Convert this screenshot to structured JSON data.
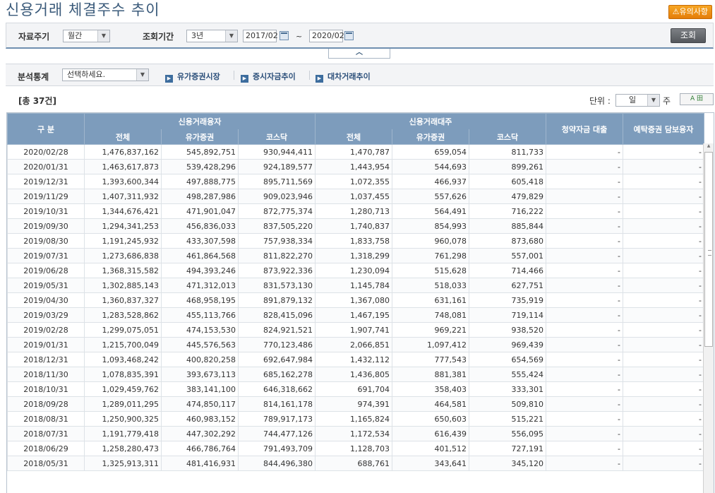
{
  "header": {
    "title": "신용거래 체결주수 추이",
    "notice_button": "⚠유의사항"
  },
  "search": {
    "period_type_label": "자료주기",
    "period_type_value": "월간",
    "range_label": "조회기간",
    "range_value": "3년",
    "start_date": "2017/02",
    "end_date": "2020/02",
    "tilde": "~",
    "query_button": "조회"
  },
  "analysis": {
    "label": "분석통계",
    "select_value": "선택하세요.",
    "links": [
      "유가증권시장",
      "증시자금추이",
      "대차거래추이"
    ]
  },
  "summary": {
    "total": "[총 37건]",
    "unit_label": "단위 :",
    "unit_value": "일",
    "unit_suffix": "주",
    "excel_label": "A 田"
  },
  "table": {
    "headers": {
      "date": "구 분",
      "group_loan": "신용거래융자",
      "group_lend": "신용거래대주",
      "subscription": "청약자금 대출",
      "deposit": "예탁증권 담보융자",
      "total": "전체",
      "kospi": "유가증권",
      "kosdaq": "코스닥"
    },
    "rows": [
      [
        "2020/02/28",
        "1,476,837,162",
        "545,892,751",
        "930,944,411",
        "1,470,787",
        "659,054",
        "811,733",
        "-",
        "-"
      ],
      [
        "2020/01/31",
        "1,463,617,873",
        "539,428,296",
        "924,189,577",
        "1,443,954",
        "544,693",
        "899,261",
        "-",
        "-"
      ],
      [
        "2019/12/31",
        "1,393,600,344",
        "497,888,775",
        "895,711,569",
        "1,072,355",
        "466,937",
        "605,418",
        "-",
        "-"
      ],
      [
        "2019/11/29",
        "1,407,311,932",
        "498,287,986",
        "909,023,946",
        "1,037,455",
        "557,626",
        "479,829",
        "-",
        "-"
      ],
      [
        "2019/10/31",
        "1,344,676,421",
        "471,901,047",
        "872,775,374",
        "1,280,713",
        "564,491",
        "716,222",
        "-",
        "-"
      ],
      [
        "2019/09/30",
        "1,294,341,253",
        "456,836,033",
        "837,505,220",
        "1,740,837",
        "854,993",
        "885,844",
        "-",
        "-"
      ],
      [
        "2019/08/30",
        "1,191,245,932",
        "433,307,598",
        "757,938,334",
        "1,833,758",
        "960,078",
        "873,680",
        "-",
        "-"
      ],
      [
        "2019/07/31",
        "1,273,686,838",
        "461,864,568",
        "811,822,270",
        "1,318,299",
        "761,298",
        "557,001",
        "-",
        "-"
      ],
      [
        "2019/06/28",
        "1,368,315,582",
        "494,393,246",
        "873,922,336",
        "1,230,094",
        "515,628",
        "714,466",
        "-",
        "-"
      ],
      [
        "2019/05/31",
        "1,302,885,143",
        "471,312,013",
        "831,573,130",
        "1,145,784",
        "518,033",
        "627,751",
        "-",
        "-"
      ],
      [
        "2019/04/30",
        "1,360,837,327",
        "468,958,195",
        "891,879,132",
        "1,367,080",
        "631,161",
        "735,919",
        "-",
        "-"
      ],
      [
        "2019/03/29",
        "1,283,528,862",
        "455,113,766",
        "828,415,096",
        "1,467,195",
        "748,081",
        "719,114",
        "-",
        "-"
      ],
      [
        "2019/02/28",
        "1,299,075,051",
        "474,153,530",
        "824,921,521",
        "1,907,741",
        "969,221",
        "938,520",
        "-",
        "-"
      ],
      [
        "2019/01/31",
        "1,215,700,049",
        "445,576,563",
        "770,123,486",
        "2,066,851",
        "1,097,412",
        "969,439",
        "-",
        "-"
      ],
      [
        "2018/12/31",
        "1,093,468,242",
        "400,820,258",
        "692,647,984",
        "1,432,112",
        "777,543",
        "654,569",
        "-",
        "-"
      ],
      [
        "2018/11/30",
        "1,078,835,391",
        "393,673,113",
        "685,162,278",
        "1,436,805",
        "881,381",
        "555,424",
        "-",
        "-"
      ],
      [
        "2018/10/31",
        "1,029,459,762",
        "383,141,100",
        "646,318,662",
        "691,704",
        "358,403",
        "333,301",
        "-",
        "-"
      ],
      [
        "2018/09/28",
        "1,289,011,295",
        "474,850,117",
        "814,161,178",
        "974,391",
        "464,581",
        "509,810",
        "-",
        "-"
      ],
      [
        "2018/08/31",
        "1,250,900,325",
        "460,983,152",
        "789,917,173",
        "1,165,824",
        "650,603",
        "515,221",
        "-",
        "-"
      ],
      [
        "2018/07/31",
        "1,191,779,418",
        "447,302,292",
        "744,477,126",
        "1,172,534",
        "616,439",
        "556,095",
        "-",
        "-"
      ],
      [
        "2018/06/29",
        "1,258,280,473",
        "466,786,764",
        "791,493,709",
        "1,128,703",
        "401,512",
        "727,191",
        "-",
        "-"
      ],
      [
        "2018/05/31",
        "1,325,913,311",
        "481,416,931",
        "844,496,380",
        "688,761",
        "343,641",
        "345,120",
        "-",
        "-"
      ]
    ]
  },
  "colors": {
    "header_bg": "#7d9cbc",
    "title": "#3a5a7a",
    "notice": "#f7a623"
  },
  "icons": [
    "calendar-icon",
    "chevron-up-icon",
    "link-arrow-icon",
    "excel-icon",
    "dropdown-arrow-icon"
  ]
}
